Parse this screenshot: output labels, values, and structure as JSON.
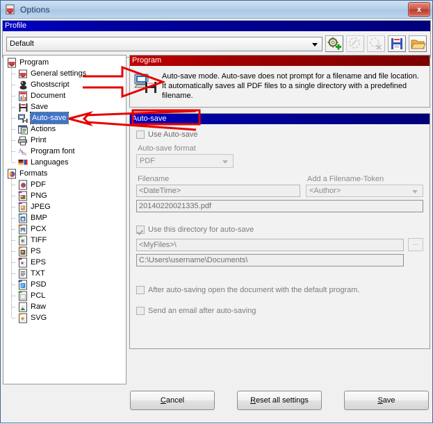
{
  "window": {
    "title": "Options",
    "icon": "pdf-options-icon",
    "close_label": "x"
  },
  "profile": {
    "group_title": "Profile",
    "selected": "Default",
    "placeholder": "Default",
    "toolbar": [
      {
        "name": "add-profile-button",
        "icon": "gear-plus-icon",
        "enabled": true
      },
      {
        "name": "rename-profile-button",
        "icon": "rename-icon",
        "enabled": false
      },
      {
        "name": "delete-profile-button",
        "icon": "delete-icon",
        "enabled": false
      },
      {
        "name": "save-profile-button",
        "icon": "floppy-icon",
        "enabled": true
      },
      {
        "name": "open-profile-button",
        "icon": "folder-icon",
        "enabled": true
      }
    ]
  },
  "tree": {
    "groups": [
      {
        "label": "Program",
        "icon": "program-icon",
        "items": [
          {
            "label": "General settings",
            "icon": "general-settings-icon",
            "selected": false
          },
          {
            "label": "Ghostscript",
            "icon": "ghostscript-icon",
            "selected": false
          },
          {
            "label": "Document",
            "icon": "document-icon",
            "selected": false
          },
          {
            "label": "Save",
            "icon": "save-icon",
            "selected": false
          },
          {
            "label": "Auto-save",
            "icon": "autosave-icon",
            "selected": true
          },
          {
            "label": "Actions",
            "icon": "actions-icon",
            "selected": false
          },
          {
            "label": "Print",
            "icon": "print-icon",
            "selected": false
          },
          {
            "label": "Program font",
            "icon": "font-icon",
            "selected": false
          },
          {
            "label": "Languages",
            "icon": "languages-icon",
            "selected": false
          }
        ]
      },
      {
        "label": "Formats",
        "icon": "formats-icon",
        "items": [
          {
            "label": "PDF",
            "icon": "pdf-icon",
            "selected": false
          },
          {
            "label": "PNG",
            "icon": "png-icon",
            "selected": false
          },
          {
            "label": "JPEG",
            "icon": "jpeg-icon",
            "selected": false
          },
          {
            "label": "BMP",
            "icon": "bmp-icon",
            "selected": false
          },
          {
            "label": "PCX",
            "icon": "pcx-icon",
            "selected": false
          },
          {
            "label": "TIFF",
            "icon": "tiff-icon",
            "selected": false
          },
          {
            "label": "PS",
            "icon": "ps-icon",
            "selected": false
          },
          {
            "label": "EPS",
            "icon": "eps-icon",
            "selected": false
          },
          {
            "label": "TXT",
            "icon": "txt-icon",
            "selected": false
          },
          {
            "label": "PSD",
            "icon": "psd-icon",
            "selected": false
          },
          {
            "label": "PCL",
            "icon": "pcl-icon",
            "selected": false
          },
          {
            "label": "Raw",
            "icon": "raw-icon",
            "selected": false
          },
          {
            "label": "SVG",
            "icon": "svg-icon",
            "selected": false
          }
        ]
      }
    ]
  },
  "program_panel": {
    "group_title": "Program",
    "icon": "monitor-floppy-icon",
    "description": "Auto-save mode. Auto-save does not prompt for a filename and file location. It automatically saves all PDF files to a single directory with a predefined filename."
  },
  "autosave": {
    "group_title": "Auto-save",
    "use_autosave": {
      "label": "Use Auto-save",
      "checked": false
    },
    "format": {
      "label": "Auto-save format",
      "value": "PDF"
    },
    "filename": {
      "label": "Filename",
      "value": "<DateTime>"
    },
    "token": {
      "label": "Add a Filename-Token",
      "value": "<Author>"
    },
    "filename_preview": "20140220021335.pdf",
    "use_directory": {
      "label": "Use this directory for auto-save",
      "checked": true
    },
    "directory": {
      "value": "<MyFiles>\\",
      "browse_label": "..."
    },
    "directory_resolved": "C:\\Users\\username\\Documents\\",
    "open_after": {
      "label": "After auto-saving open the document with the default program.",
      "checked": false
    },
    "send_email": {
      "label": "Send an email after auto-saving",
      "checked": false
    }
  },
  "buttons": {
    "cancel": {
      "accel": "C",
      "rest": "ancel"
    },
    "reset": {
      "accel": "R",
      "rest": "eset all settings"
    },
    "save": {
      "accel": "S",
      "rest": "ave"
    }
  },
  "colors": {
    "group_header_blue": "#0000a0",
    "group_header_red": "#a00000",
    "selection_blue": "#3d74c8",
    "annotation_red": "#e60000",
    "title_blue": "#a9c7e6"
  }
}
